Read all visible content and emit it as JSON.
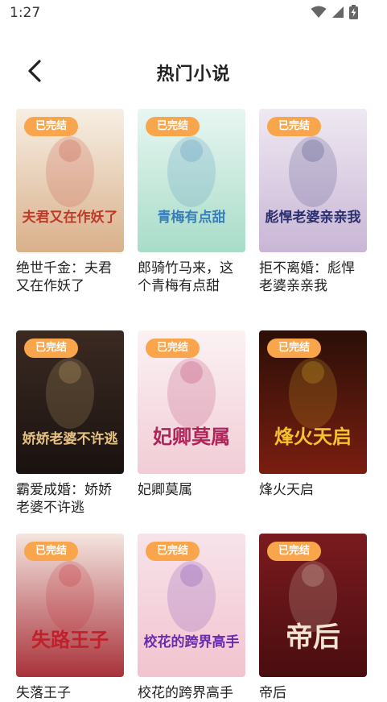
{
  "status_bar": {
    "time": "1:27"
  },
  "header": {
    "title": "热门小说"
  },
  "colors": {
    "badge": "#F8A54B",
    "title_text": "#222222"
  },
  "books": [
    {
      "title": "绝世千金：夫君又在作妖了",
      "status": "已完结",
      "cover_text": "夫君又在作妖了",
      "cover_colors": [
        "#f7efe4",
        "#d9b08a",
        "#c0392b"
      ]
    },
    {
      "title": "郎骑竹马来，这个青梅有点甜",
      "status": "已完结",
      "cover_text": "青梅有点甜",
      "cover_colors": [
        "#e8f6f1",
        "#a8dcc8",
        "#3a7fb8"
      ]
    },
    {
      "title": "拒不离婚：彪悍老婆亲亲我",
      "status": "已完结",
      "cover_text": "彪悍老婆亲亲我",
      "cover_colors": [
        "#efe9f2",
        "#c9b6d6",
        "#2c2f6e"
      ]
    },
    {
      "title": "霸爱成婚：娇娇老婆不许逃",
      "status": "已完结",
      "cover_text": "娇娇老婆不许逃",
      "cover_colors": [
        "#3b2a22",
        "#1a1210",
        "#e6c280"
      ]
    },
    {
      "title": "妃卿莫属",
      "status": "已完结",
      "cover_text": "妃卿莫属",
      "cover_colors": [
        "#fbf2f3",
        "#f1cdd6",
        "#b0245a"
      ]
    },
    {
      "title": "烽火天启",
      "status": "已完结",
      "cover_text": "烽火天启",
      "cover_colors": [
        "#2a0f08",
        "#7a1e10",
        "#f5c22d"
      ]
    },
    {
      "title": "失落王子",
      "status": "已完结",
      "cover_text": "失路王子",
      "cover_colors": [
        "#f4e6e0",
        "#a8323a",
        "#c01f2c"
      ]
    },
    {
      "title": "校花的跨界高手",
      "status": "已完结",
      "cover_text": "校花的跨界高手",
      "cover_colors": [
        "#f7e3ea",
        "#f2c3cf",
        "#6a2caa"
      ]
    },
    {
      "title": "帝后",
      "status": "已完结",
      "cover_text": "帝后",
      "cover_colors": [
        "#7a1b1f",
        "#4a0d10",
        "#f3e4d2"
      ]
    }
  ]
}
